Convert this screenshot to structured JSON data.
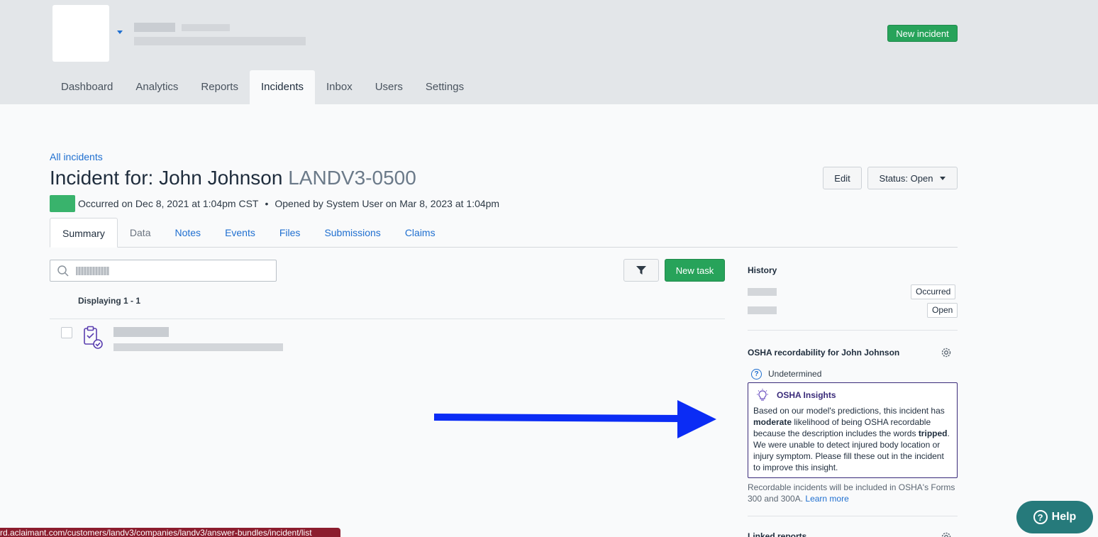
{
  "header": {
    "new_incident_label": "New incident"
  },
  "nav": {
    "items": [
      {
        "label": "Dashboard"
      },
      {
        "label": "Analytics"
      },
      {
        "label": "Reports"
      },
      {
        "label": "Incidents"
      },
      {
        "label": "Inbox"
      },
      {
        "label": "Users"
      },
      {
        "label": "Settings"
      }
    ],
    "active": "Incidents"
  },
  "incident": {
    "breadcrumb": "All incidents",
    "title_prefix": "Incident for: John Johnson",
    "code": "LANDV3-0500",
    "occurred": "Occurred on Dec 8, 2021 at 1:04pm CST",
    "separator": "•",
    "opened": "Opened by System User on Mar 8, 2023 at 1:04pm",
    "edit_label": "Edit",
    "status_label": "Status: Open"
  },
  "tabs": [
    {
      "label": "Summary"
    },
    {
      "label": "Data"
    },
    {
      "label": "Notes"
    },
    {
      "label": "Events"
    },
    {
      "label": "Files"
    },
    {
      "label": "Submissions"
    },
    {
      "label": "Claims"
    }
  ],
  "tasks": {
    "new_task_label": "New task",
    "displaying": "Displaying 1 - 1"
  },
  "sidebar": {
    "history_heading": "History",
    "history_badges": [
      "Occurred",
      "Open"
    ],
    "osha_heading": "OSHA recordability for John Johnson",
    "osha_status": "Undetermined",
    "insights_title": "OSHA Insights",
    "insights_p1": "Based on our model's predictions, this incident has ",
    "insights_b1": "moderate",
    "insights_p2": " likelihood of being OSHA recordable because the description includes the words ",
    "insights_b2": "tripped",
    "insights_p3": ". We were unable to detect injured body location or injury symptom. Please fill these out in the incident to improve this insight.",
    "note_text": "Recordable incidents will be included in OSHA's Forms 300 and 300A. ",
    "learn_more": "Learn more",
    "linked_reports": "Linked reports"
  },
  "help": {
    "label": "Help"
  },
  "status_bar": {
    "url": "rd.aclaimant.com/customers/landv3/companies/landv3/answer-bundles/incident/list"
  },
  "colors": {
    "primary_green": "#27a35a",
    "link_blue": "#1f6fd0",
    "insights_purple": "#3a2b7a",
    "help_teal": "#267a7b",
    "arrow_blue": "#0b2cf5"
  }
}
